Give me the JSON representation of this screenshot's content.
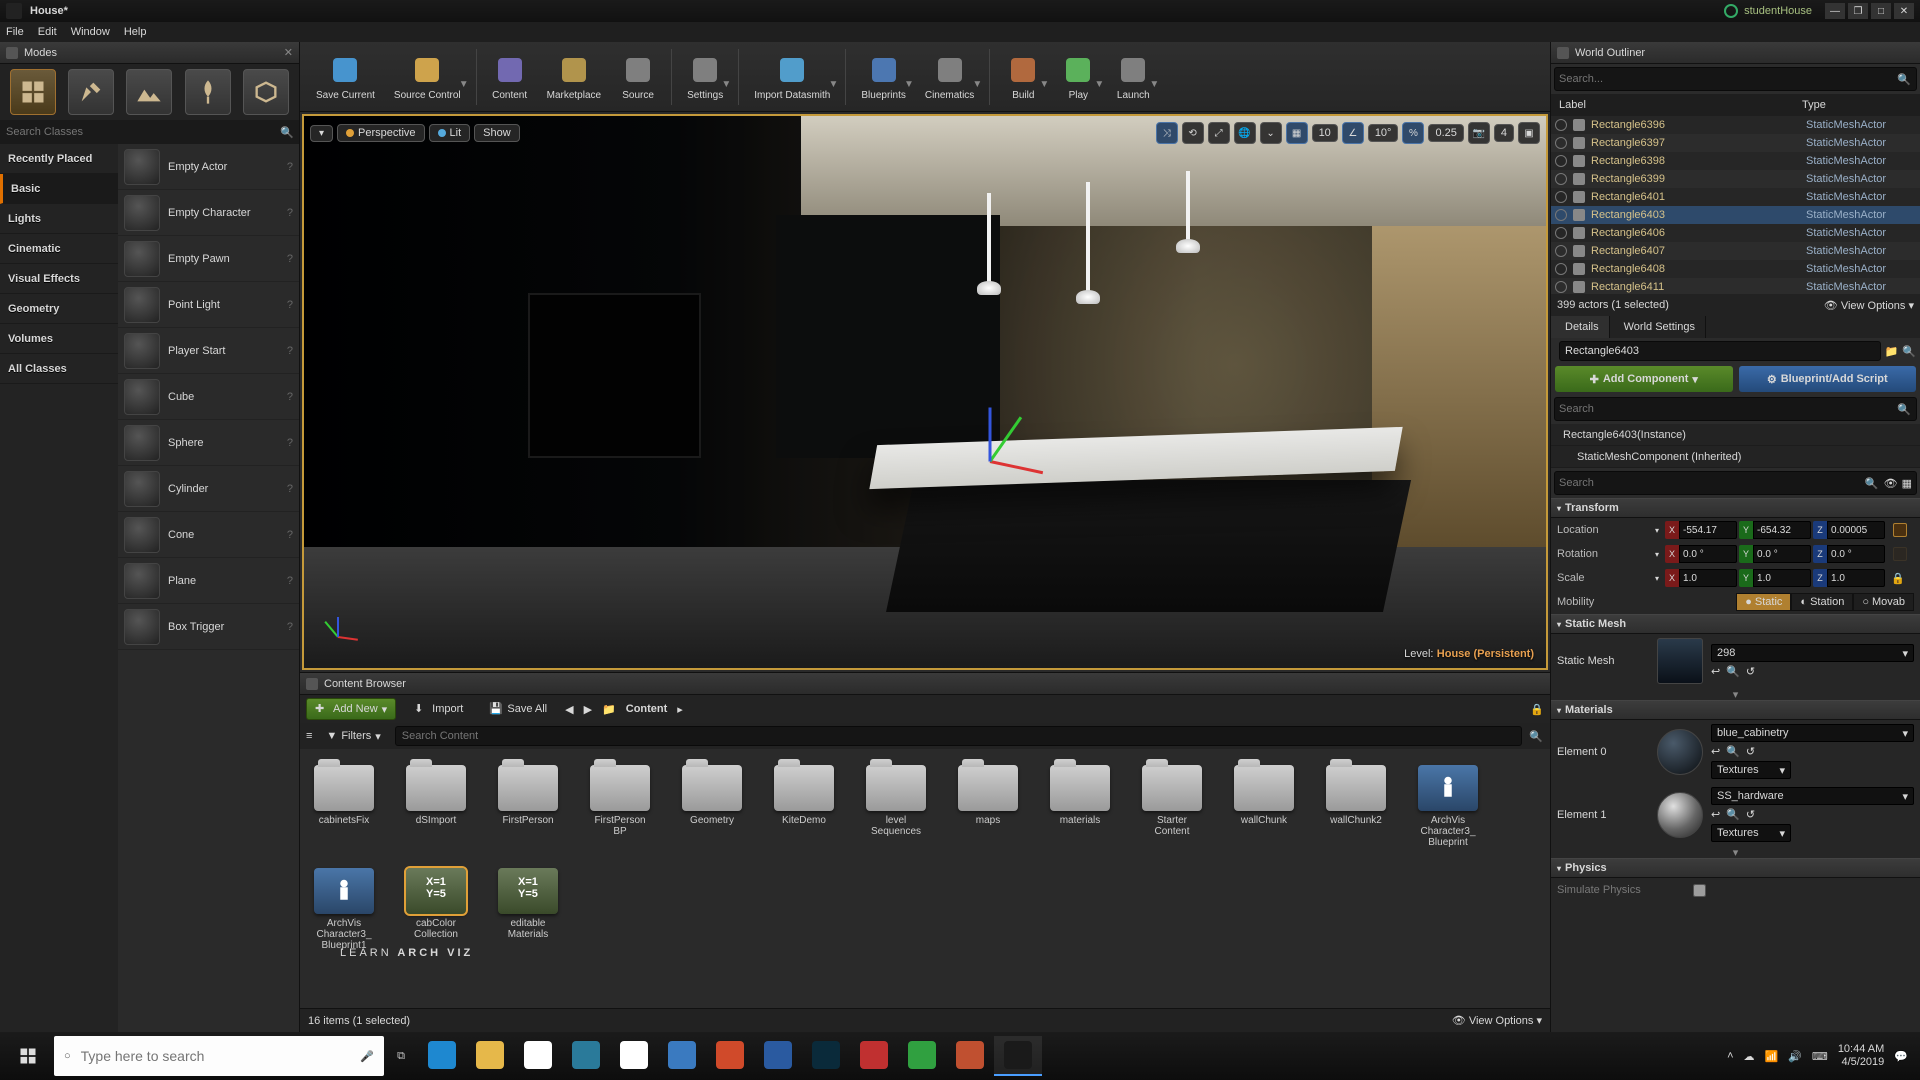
{
  "titlebar": {
    "tab": "House*",
    "project": "studentHouse"
  },
  "menu": [
    "File",
    "Edit",
    "Window",
    "Help"
  ],
  "modes": {
    "title": "Modes",
    "search_placeholder": "Search Classes",
    "categories": [
      "Recently Placed",
      "Basic",
      "Lights",
      "Cinematic",
      "Visual Effects",
      "Geometry",
      "Volumes",
      "All Classes"
    ],
    "selected_category": "Basic",
    "items": [
      "Empty Actor",
      "Empty Character",
      "Empty Pawn",
      "Point Light",
      "Player Start",
      "Cube",
      "Sphere",
      "Cylinder",
      "Cone",
      "Plane",
      "Box Trigger"
    ]
  },
  "toolbar": [
    {
      "label": "Save Current",
      "icon": "save"
    },
    {
      "label": "Source Control",
      "icon": "source",
      "drop": true
    },
    {
      "label": "Content",
      "icon": "content"
    },
    {
      "label": "Marketplace",
      "icon": "market"
    },
    {
      "label": "Source",
      "icon": "srcpanel"
    },
    {
      "label": "Settings",
      "icon": "gear",
      "drop": true
    },
    {
      "label": "Import Datasmith",
      "icon": "datasmith",
      "drop": true
    },
    {
      "label": "Blueprints",
      "icon": "bp",
      "drop": true
    },
    {
      "label": "Cinematics",
      "icon": "cine",
      "drop": true
    },
    {
      "label": "Build",
      "icon": "build",
      "drop": true
    },
    {
      "label": "Play",
      "icon": "play",
      "drop": true
    },
    {
      "label": "Launch",
      "icon": "launch",
      "drop": true
    }
  ],
  "viewport": {
    "perspective": "Perspective",
    "lit": "Lit",
    "show": "Show",
    "grid_snap": "10",
    "angle_snap": "10°",
    "scale_snap": "0.25",
    "cam_speed": "4",
    "level_label": "Level:",
    "level_name": "House (Persistent)"
  },
  "content_browser": {
    "title": "Content Browser",
    "add": "Add New",
    "import": "Import",
    "saveall": "Save All",
    "path": "Content",
    "filters": "Filters",
    "search_placeholder": "Search Content",
    "assets": [
      {
        "name": "cabinetsFix",
        "type": "folder"
      },
      {
        "name": "dSImport",
        "type": "folder"
      },
      {
        "name": "FirstPerson",
        "type": "folder"
      },
      {
        "name": "FirstPerson\nBP",
        "type": "folder"
      },
      {
        "name": "Geometry",
        "type": "folder"
      },
      {
        "name": "KiteDemo",
        "type": "folder"
      },
      {
        "name": "level\nSequences",
        "type": "folder"
      },
      {
        "name": "maps",
        "type": "folder"
      },
      {
        "name": "materials",
        "type": "folder"
      },
      {
        "name": "Starter\nContent",
        "type": "folder"
      },
      {
        "name": "wallChunk",
        "type": "folder"
      },
      {
        "name": "wallChunk2",
        "type": "folder"
      },
      {
        "name": "ArchVis\nCharacter3_\nBlueprint",
        "type": "bp"
      },
      {
        "name": "ArchVis\nCharacter3_\nBlueprint1",
        "type": "bp"
      },
      {
        "name": "cabColor\nCollection",
        "type": "coll",
        "selected": true,
        "badge": "X=1\nY=5"
      },
      {
        "name": "editable\nMaterials",
        "type": "coll",
        "badge": "X=1\nY=5"
      }
    ],
    "status": "16 items (1 selected)",
    "view_options": "View Options"
  },
  "watermark_a": "LEARN",
  "watermark_b": " ARCH VIZ",
  "outliner": {
    "title": "World Outliner",
    "search_placeholder": "Search...",
    "col_label": "Label",
    "col_type": "Type",
    "rows": [
      {
        "name": "Rectangle6396",
        "type": "StaticMeshActor"
      },
      {
        "name": "Rectangle6397",
        "type": "StaticMeshActor"
      },
      {
        "name": "Rectangle6398",
        "type": "StaticMeshActor"
      },
      {
        "name": "Rectangle6399",
        "type": "StaticMeshActor"
      },
      {
        "name": "Rectangle6401",
        "type": "StaticMeshActor"
      },
      {
        "name": "Rectangle6403",
        "type": "StaticMeshActor",
        "selected": true
      },
      {
        "name": "Rectangle6406",
        "type": "StaticMeshActor"
      },
      {
        "name": "Rectangle6407",
        "type": "StaticMeshActor"
      },
      {
        "name": "Rectangle6408",
        "type": "StaticMeshActor"
      },
      {
        "name": "Rectangle6411",
        "type": "StaticMeshActor"
      }
    ],
    "footer": "399 actors (1 selected)",
    "view_options": "View Options"
  },
  "details": {
    "tab_details": "Details",
    "tab_world": "World Settings",
    "actor_name": "Rectangle6403",
    "add_component": "Add Component",
    "bp_script": "Blueprint/Add Script",
    "search_placeholder": "Search",
    "comp_instance": "Rectangle6403(Instance)",
    "comp_mesh": "StaticMeshComponent (Inherited)",
    "section_transform": "Transform",
    "location": "Location",
    "rotation": "Rotation",
    "scale": "Scale",
    "mobility": "Mobility",
    "loc": {
      "x": "-554.17",
      "y": "-654.32",
      "z": "0.00005"
    },
    "rot": {
      "x": "0.0 °",
      "y": "0.0 °",
      "z": "0.0 °"
    },
    "scl": {
      "x": "1.0",
      "y": "1.0",
      "z": "1.0"
    },
    "mob_static": "Static",
    "mob_station": "Station",
    "mob_movab": "Movab",
    "section_staticmesh": "Static Mesh",
    "sm_label": "Static Mesh",
    "sm_value": "298",
    "section_materials": "Materials",
    "el0": "Element 0",
    "el0_mat": "blue_cabinetry",
    "tex": "Textures",
    "el1": "Element 1",
    "el1_mat": "SS_hardware",
    "section_physics": "Physics",
    "physics_sim": "Simulate Physics"
  },
  "taskbar": {
    "search_placeholder": "Type here to search",
    "time": "10:44 AM",
    "date": "4/5/2019",
    "apps": [
      "edge",
      "explorer",
      "store",
      "movies",
      "chrome",
      "s1",
      "powerpoint",
      "word",
      "photoshop",
      "xb",
      "n",
      "cam",
      "ue"
    ]
  },
  "colors": {
    "edge": "#1e88d0",
    "explorer": "#e6b84a",
    "store": "#ffffff",
    "movies": "#2a7a9a",
    "chrome": "#ffffff",
    "s1": "#3a7ac0",
    "powerpoint": "#d04a2a",
    "word": "#2a5aa0",
    "photoshop": "#0a2a3a",
    "xb": "#c03030",
    "n": "#30a040",
    "cam": "#c05030",
    "ue": "#1a1a1a"
  }
}
